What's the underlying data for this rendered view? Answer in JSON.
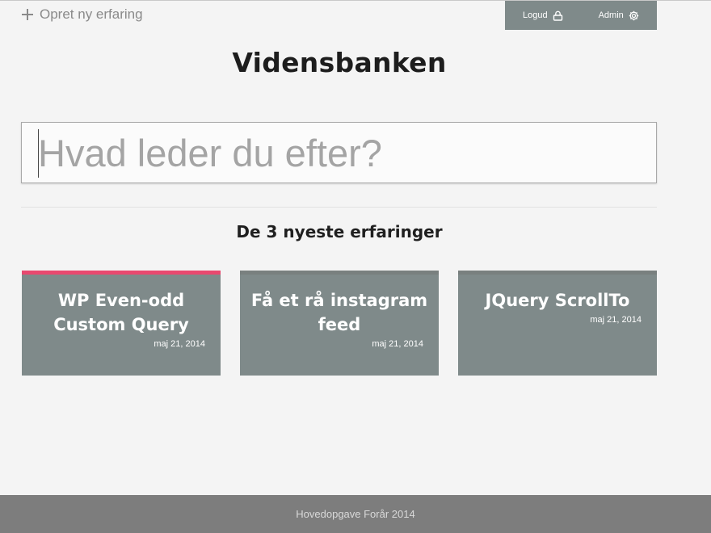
{
  "nav": {
    "new_experience_label": "Opret ny erfaring"
  },
  "userbar": {
    "logout_label": "Logud",
    "admin_label": "Admin",
    "background": "#7f8a8a"
  },
  "site": {
    "title": "Vidensbanken"
  },
  "search": {
    "placeholder": "Hvad leder du efter?",
    "value": ""
  },
  "latest": {
    "heading": "De 3 nyeste erfaringer",
    "cards": [
      {
        "title": "WP Even-odd Custom Query",
        "date": "maj 21, 2014",
        "highlighted": true
      },
      {
        "title": "Få et rå instagram feed",
        "date": "maj 21, 2014",
        "highlighted": false
      },
      {
        "title": "JQuery ScrollTo",
        "date": "maj 21, 2014",
        "highlighted": false
      }
    ]
  },
  "colors": {
    "accent": "#e8496f",
    "card": "#7f8a8a",
    "footer": "#7d7d7d"
  },
  "icons": {
    "new_experience": "plus-icon",
    "logout": "lock-icon",
    "admin": "gear-icon"
  },
  "footer": {
    "text": "Hovedopgave Forår 2014"
  }
}
